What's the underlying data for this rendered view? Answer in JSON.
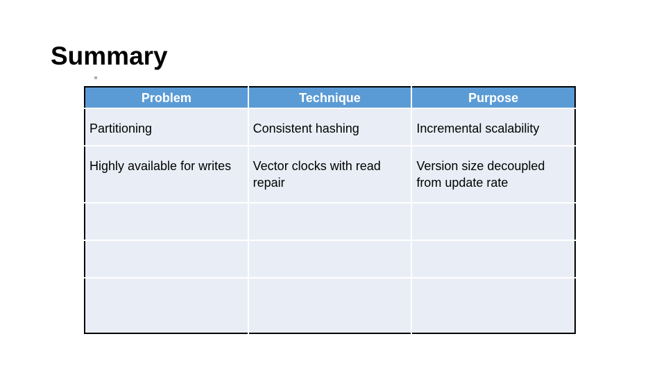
{
  "slide": {
    "title": "Summary",
    "table": {
      "headers": [
        "Problem",
        "Technique",
        "Purpose"
      ],
      "rows": [
        [
          "Partitioning",
          "Consistent hashing",
          "Incremental scalability"
        ],
        [
          "Highly available for writes",
          "Vector clocks with read repair",
          "Version size decoupled from update rate"
        ],
        [
          "",
          "",
          ""
        ],
        [
          "",
          "",
          ""
        ],
        [
          "",
          "",
          ""
        ]
      ]
    },
    "colors": {
      "header_bg": "#5b9bd5",
      "cell_bg": "#e9eef6",
      "header_text": "#ffffff"
    }
  }
}
